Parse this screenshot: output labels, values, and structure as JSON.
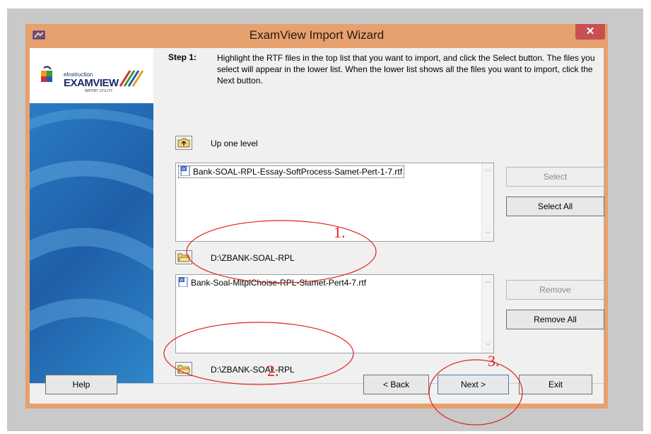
{
  "window": {
    "title": "ExamView Import Wizard",
    "close_glyph": "✕"
  },
  "logo": {
    "brand": "EXAMVIEW",
    "tagline": "eInstruction",
    "sub": "IMPORT UTILITY"
  },
  "step": {
    "label": "Step 1:",
    "instructions": "Highlight the RTF files in the top list that you want to import, and click the Select button.  The files you select will appear in the lower list.  When the lower list shows all the files you want to import, click the Next button."
  },
  "up_level": {
    "label": "Up one level"
  },
  "top_list": {
    "items": [
      "Bank-SOAL-RPL-Essay-SoftProcess-Samet-Pert-1-7.rtf"
    ]
  },
  "top_path": "D:\\ZBANK-SOAL-RPL",
  "bottom_list": {
    "items": [
      "Bank-Soal-MltplChoise-RPL-Slamet-Pert4-7.rtf"
    ]
  },
  "bottom_path": "D:\\ZBANK-SOAL-RPL",
  "buttons": {
    "select": "Select",
    "select_all": "Select All",
    "remove": "Remove",
    "remove_all": "Remove All",
    "help": "Help",
    "back": "< Back",
    "next": "Next >",
    "exit": "Exit"
  },
  "annotations": [
    "1.",
    "2.",
    "3."
  ],
  "colors": {
    "frame": "#e6a16e",
    "annotation": "#e02020",
    "sidebar_blue": "#2a7cc4"
  }
}
